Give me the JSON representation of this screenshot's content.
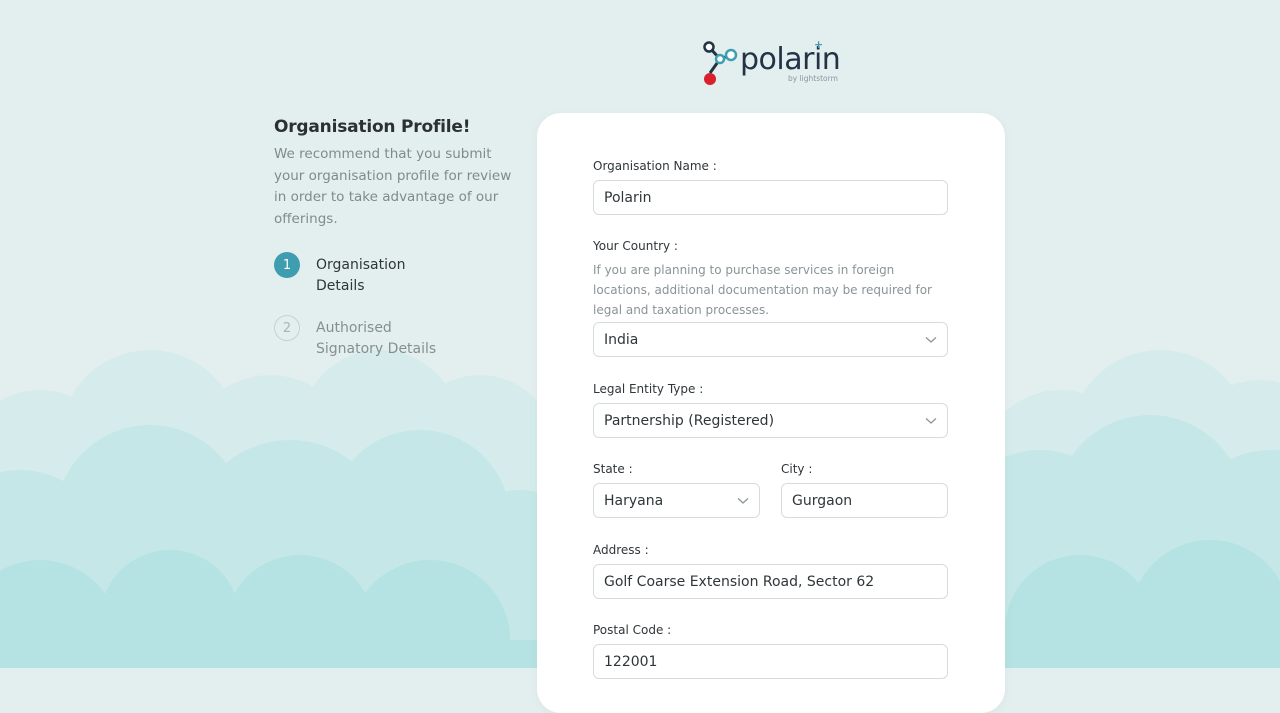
{
  "brand": {
    "name": "polarin",
    "tagline": "by lightstorm",
    "colors": {
      "primary": "#3f9db0",
      "dark": "#233245",
      "accent_red": "#d9202d"
    }
  },
  "intro": {
    "title": "Organisation Profile!",
    "description": "We recommend that you submit your organisation profile for review in order to take advantage of our offerings."
  },
  "steps": [
    {
      "number": "1",
      "label": "Organisation Details",
      "state": "active"
    },
    {
      "number": "2",
      "label": "Authorised Signatory Details",
      "state": "inactive"
    }
  ],
  "form": {
    "org_name": {
      "label": "Organisation Name :",
      "value": "Polarin"
    },
    "country": {
      "label": "Your Country :",
      "hint": "If you are planning to purchase services in foreign locations, additional documentation may be required for legal and taxation processes.",
      "value": "India",
      "icon": "chevron-down-icon"
    },
    "legal_entity": {
      "label": "Legal Entity Type :",
      "value": "Partnership (Registered)",
      "icon": "chevron-down-icon"
    },
    "state": {
      "label": "State :",
      "value": "Haryana",
      "icon": "chevron-down-icon"
    },
    "city": {
      "label": "City :",
      "value": "Gurgaon"
    },
    "address": {
      "label": "Address :",
      "value": "Golf Coarse Extension Road, Sector 62"
    },
    "postal_code": {
      "label": "Postal Code :",
      "value": "122001"
    }
  }
}
